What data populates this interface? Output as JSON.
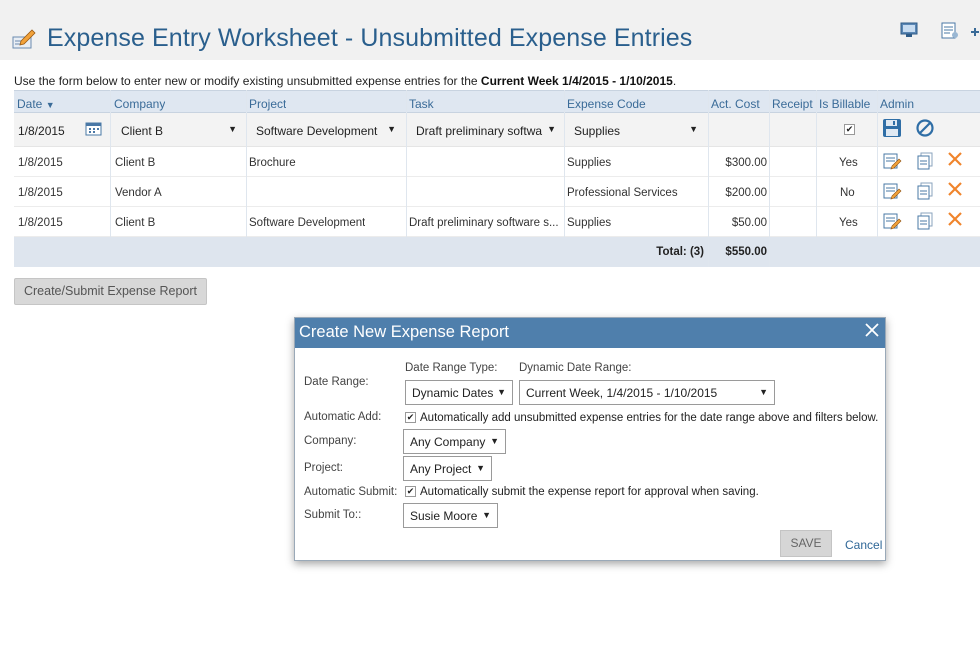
{
  "header": {
    "title": "Expense Entry Worksheet - Unsubmitted Expense Entries"
  },
  "intro": {
    "text": "Use the form below to enter new or modify existing unsubmitted expense entries for the",
    "period": "Current Week 1/4/2015 - 1/10/2015",
    "period_suffix": "."
  },
  "grid": {
    "columns": [
      "Date",
      "Company",
      "Project",
      "Task",
      "Expense Code",
      "Act. Cost",
      "Receipt",
      "Is Billable",
      "Admin"
    ],
    "sort_indicator": "▼",
    "edit_row": {
      "date": "1/8/2015",
      "company": "Client B",
      "project": "Software Development",
      "task": "Draft preliminary softwa",
      "expense_code": "Supplies",
      "is_billable_checked": "✔"
    },
    "rows": [
      {
        "date": "1/8/2015",
        "company": "Client B",
        "project": "Brochure",
        "task": "",
        "expense_code": "Supplies",
        "act_cost": "$300.00",
        "receipt": "",
        "is_billable": "Yes"
      },
      {
        "date": "1/8/2015",
        "company": "Vendor A",
        "project": "",
        "task": "",
        "expense_code": "Professional Services",
        "act_cost": "$200.00",
        "receipt": "",
        "is_billable": "No"
      },
      {
        "date": "1/8/2015",
        "company": "Client B",
        "project": "Software Development",
        "task": "Draft preliminary software s...",
        "expense_code": "Supplies",
        "act_cost": "$50.00",
        "receipt": "",
        "is_billable": "Yes"
      }
    ],
    "total_label": "Total: (3)",
    "total_value": "$550.00"
  },
  "actions": {
    "create_submit_label": "Create/Submit Expense Report"
  },
  "modal": {
    "title": "Create New Expense Report",
    "date_range_label": "Date Range:",
    "date_range_type_label": "Date Range Type:",
    "dynamic_date_range_label": "Dynamic Date Range:",
    "date_range_type_value": "Dynamic Dates",
    "dynamic_date_range_value": "Current Week, 1/4/2015 - 1/10/2015",
    "automatic_add_label": "Automatic Add:",
    "automatic_add_text": "Automatically add unsubmitted expense entries for the date range above and filters below.",
    "company_label": "Company:",
    "company_value": "Any Company",
    "project_label": "Project:",
    "project_value": "Any Project",
    "automatic_submit_label": "Automatic Submit:",
    "automatic_submit_text": "Automatically submit the expense report for approval when saving.",
    "submit_to_label": "Submit To::",
    "submit_to_value": "Susie Moore",
    "save_label": "SAVE",
    "cancel_label": "Cancel",
    "checkmark": "✔"
  },
  "colors": {
    "title": "#2a5f8d",
    "modal_header": "#4f7fac",
    "grid_header": "#dfe7f1",
    "delete_icon": "#f0842c"
  },
  "icons": [
    "edit-page-icon",
    "monitor-icon",
    "report-icon",
    "calendar-icon",
    "save-icon",
    "cancel-icon",
    "edit-icon",
    "copy-icon",
    "delete-icon",
    "close-icon"
  ]
}
